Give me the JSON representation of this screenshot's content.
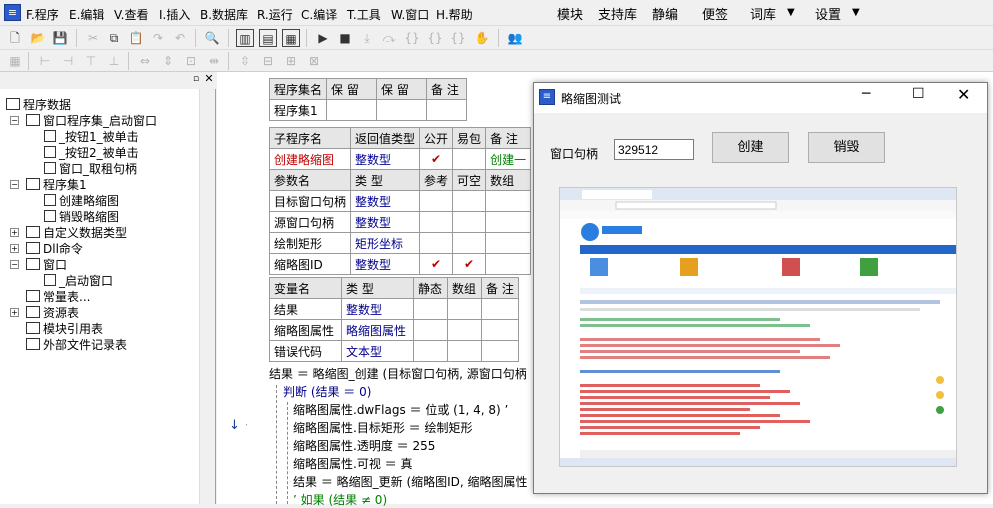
{
  "menu": {
    "items": [
      "F.程序",
      "E.编辑",
      "V.查看",
      "I.插入",
      "B.数据库",
      "R.运行",
      "C.编译",
      "T.工具",
      "W.窗口",
      "H.帮助"
    ],
    "right_items": [
      "模块",
      "支持库",
      "静编",
      "便签",
      "词库",
      "设置"
    ]
  },
  "tree": {
    "root": "程序数据",
    "nodes": [
      "窗口程序集_启动窗口",
      "_按钮1_被单击",
      "_按钮2_被单击",
      "窗口_取租句柄",
      "程序集1",
      "创建略缩图",
      "销毁略缩图",
      "自定义数据类型",
      "Dll命令",
      "窗口",
      "_启动窗口",
      "常量表...",
      "资源表",
      "模块引用表",
      "外部文件记录表"
    ]
  },
  "code": {
    "assembly_table": {
      "headers": [
        "程序集名",
        "保 留",
        "保 留",
        "备 注"
      ],
      "row": [
        "程序集1",
        "",
        "",
        ""
      ]
    },
    "sub_table": {
      "headers": [
        "子程序名",
        "返回值类型",
        "公开",
        "易包",
        "备 注"
      ],
      "row": [
        "创建略缩图",
        "整数型",
        "✔",
        "",
        "创建一"
      ]
    },
    "param_table": {
      "headers": [
        "参数名",
        "类 型",
        "参考",
        "可空",
        "数组"
      ],
      "rows": [
        [
          "目标窗口句柄",
          "整数型",
          "",
          "",
          ""
        ],
        [
          "源窗口句柄",
          "整数型",
          "",
          "",
          ""
        ],
        [
          "绘制矩形",
          "矩形坐标",
          "",
          "",
          ""
        ],
        [
          "缩略图ID",
          "整数型",
          "✔",
          "✔",
          ""
        ]
      ]
    },
    "var_table": {
      "headers": [
        "变量名",
        "类 型",
        "静态",
        "数组",
        "备 注"
      ],
      "rows": [
        [
          "结果",
          "整数型",
          "",
          "",
          ""
        ],
        [
          "缩略图属性",
          "略缩图属性",
          "",
          "",
          ""
        ],
        [
          "错误代码",
          "文本型",
          "",
          "",
          ""
        ]
      ]
    },
    "lines": [
      "结果 ＝ 略缩图_创建 (目标窗口句柄, 源窗口句柄",
      "判断 (结果 ＝ 0)",
      "缩略图属性.dwFlags ＝ 位或 (1, 4, 8) ’",
      "缩略图属性.目标矩形 ＝ 绘制矩形",
      "缩略图属性.透明度 ＝ 255",
      "缩略图属性.可视 ＝ 真",
      "结果 ＝ 略缩图_更新 (缩略图ID, 缩略图属性",
      "’ 如果 (结果 ≠ 0)"
    ],
    "gutter_marks": [
      "↓",
      "+"
    ]
  },
  "window": {
    "title": "略缩图测试",
    "handle_label": "窗口句柄",
    "handle_value": "329512",
    "create_label": "创建",
    "destroy_label": "销毁"
  },
  "colors": {
    "keyword_blue": "#00008b",
    "call_red": "#c00000",
    "comment_green": "#008000"
  }
}
